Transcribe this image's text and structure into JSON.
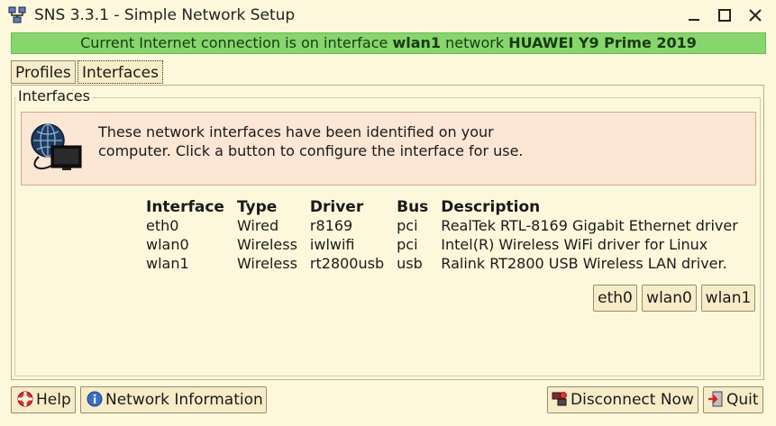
{
  "window": {
    "title": "SNS 3.3.1 - Simple Network Setup"
  },
  "status": {
    "prefix": "Current Internet connection is on interface",
    "interface": "wlan1",
    "middle": "network",
    "network": "HUAWEI Y9 Prime 2019",
    "color": "#86d66d"
  },
  "tabs": [
    {
      "label": "Profiles",
      "active": false
    },
    {
      "label": "Interfaces",
      "active": true
    }
  ],
  "section": {
    "label": "Interfaces",
    "info_line1": "These network interfaces have been identified on your",
    "info_line2": "computer. Click a button to configure the interface for use."
  },
  "table": {
    "headers": [
      "Interface",
      "Type",
      "Driver",
      "Bus",
      "Description"
    ],
    "rows": [
      [
        "eth0",
        "Wired",
        "r8169",
        "pci",
        "RealTek RTL-8169 Gigabit Ethernet driver"
      ],
      [
        "wlan0",
        "Wireless",
        "iwlwifi",
        "pci",
        "Intel(R) Wireless WiFi driver for Linux"
      ],
      [
        "wlan1",
        "Wireless",
        "rt2800usb",
        "usb",
        "Ralink RT2800 USB Wireless LAN driver."
      ]
    ]
  },
  "iface_buttons": [
    "eth0",
    "wlan0",
    "wlan1"
  ],
  "footer": {
    "help": "Help",
    "network_info": "Network Information",
    "disconnect": "Disconnect Now",
    "quit": "Quit"
  }
}
